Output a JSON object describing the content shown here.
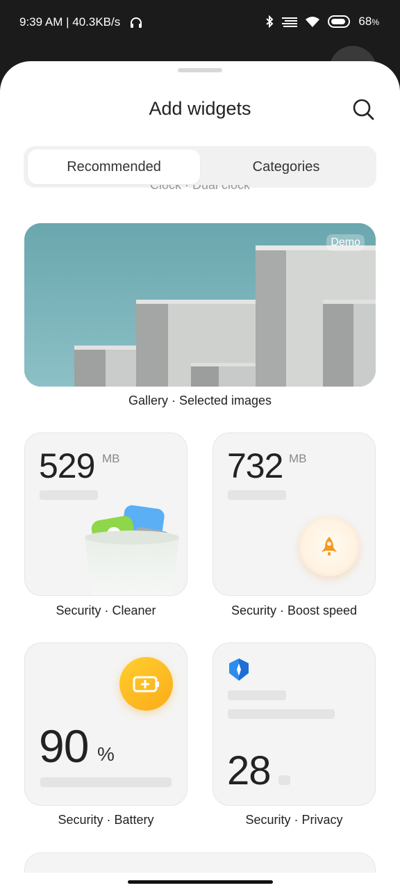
{
  "status": {
    "time": "9:39 AM | 40.3KB/s",
    "battery": "68",
    "battery_unit": "%"
  },
  "sheet": {
    "title": "Add widgets"
  },
  "tabs": [
    {
      "label": "Recommended",
      "active": true
    },
    {
      "label": "Categories",
      "active": false
    }
  ],
  "partial_label": "Clock · Dual clock",
  "gallery": {
    "badge": "Demo",
    "caption": "Gallery · Selected images"
  },
  "widgets": {
    "cleaner": {
      "value": "529",
      "unit": "MB",
      "caption": "Security · Cleaner"
    },
    "boost": {
      "value": "732",
      "unit": "MB",
      "caption": "Security · Boost speed"
    },
    "battery": {
      "value": "90",
      "unit": "%",
      "caption": "Security · Battery"
    },
    "privacy": {
      "value": "28",
      "caption": "Security · Privacy"
    }
  },
  "colors": {
    "accent_orange": "#f39a1e",
    "battery_yellow": "#fcbc22",
    "privacy_blue": "#2d8cf0"
  }
}
